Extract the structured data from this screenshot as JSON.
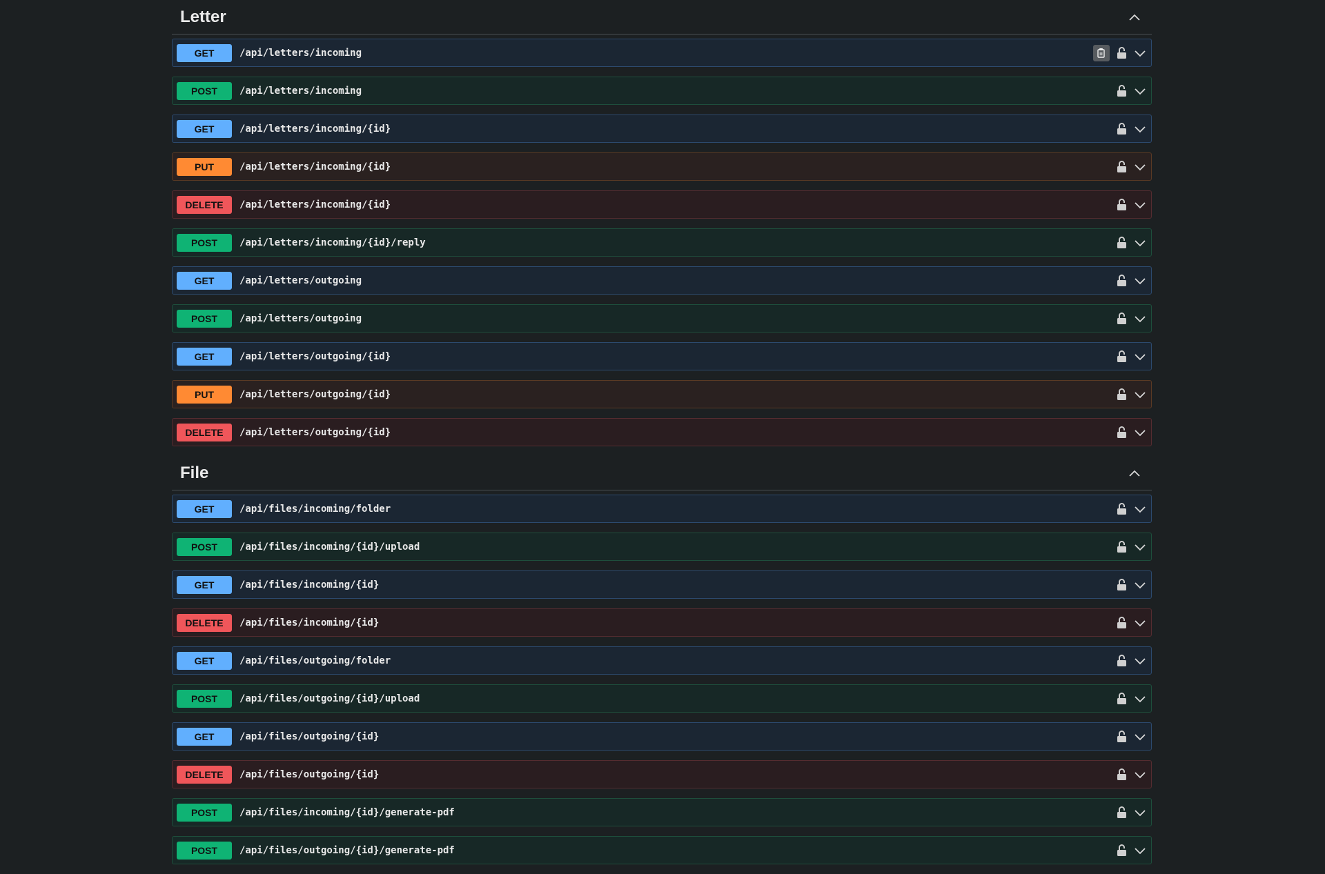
{
  "sections": [
    {
      "title": "Letter",
      "ops": [
        {
          "method": "GET",
          "path": "/api/letters/incoming",
          "copy": true
        },
        {
          "method": "POST",
          "path": "/api/letters/incoming"
        },
        {
          "method": "GET",
          "path": "/api/letters/incoming/{id}"
        },
        {
          "method": "PUT",
          "path": "/api/letters/incoming/{id}"
        },
        {
          "method": "DELETE",
          "path": "/api/letters/incoming/{id}"
        },
        {
          "method": "POST",
          "path": "/api/letters/incoming/{id}/reply"
        },
        {
          "method": "GET",
          "path": "/api/letters/outgoing"
        },
        {
          "method": "POST",
          "path": "/api/letters/outgoing"
        },
        {
          "method": "GET",
          "path": "/api/letters/outgoing/{id}"
        },
        {
          "method": "PUT",
          "path": "/api/letters/outgoing/{id}"
        },
        {
          "method": "DELETE",
          "path": "/api/letters/outgoing/{id}"
        }
      ]
    },
    {
      "title": "File",
      "ops": [
        {
          "method": "GET",
          "path": "/api/files/incoming/folder"
        },
        {
          "method": "POST",
          "path": "/api/files/incoming/{id}/upload"
        },
        {
          "method": "GET",
          "path": "/api/files/incoming/{id}"
        },
        {
          "method": "DELETE",
          "path": "/api/files/incoming/{id}"
        },
        {
          "method": "GET",
          "path": "/api/files/outgoing/folder"
        },
        {
          "method": "POST",
          "path": "/api/files/outgoing/{id}/upload"
        },
        {
          "method": "GET",
          "path": "/api/files/outgoing/{id}"
        },
        {
          "method": "DELETE",
          "path": "/api/files/outgoing/{id}"
        },
        {
          "method": "POST",
          "path": "/api/files/incoming/{id}/generate-pdf"
        },
        {
          "method": "POST",
          "path": "/api/files/outgoing/{id}/generate-pdf"
        }
      ]
    }
  ],
  "icons": {
    "toggle": "chevron-up-icon",
    "lock": "lock-icon",
    "expand": "chevron-down-icon",
    "copy": "copy-icon"
  },
  "colors": {
    "get": "#61affe",
    "post": "#0fb374",
    "put": "#ff8a33",
    "delete": "#f0565a",
    "background": "#1c2022"
  }
}
